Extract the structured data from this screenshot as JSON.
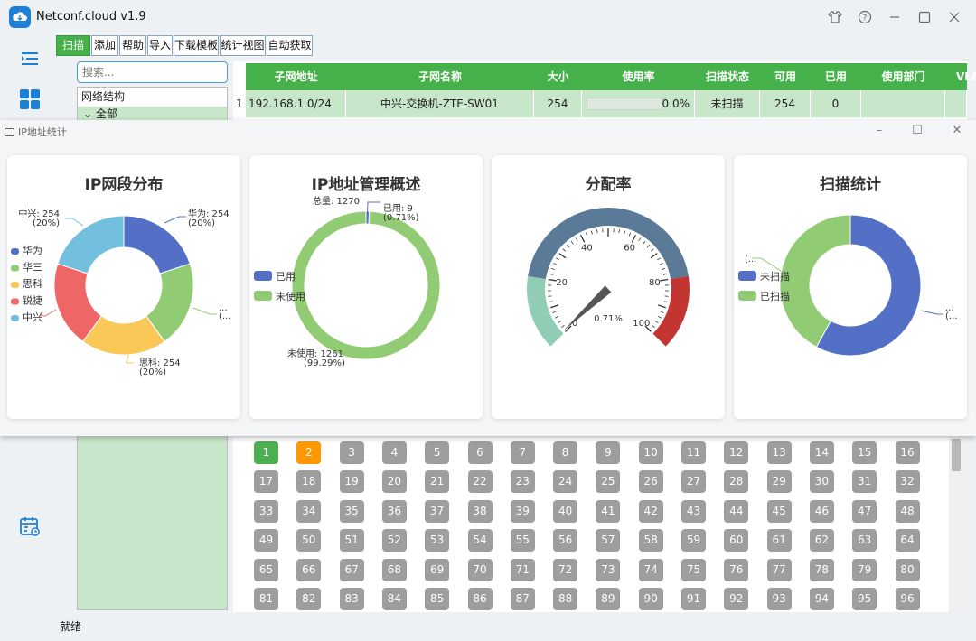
{
  "app": {
    "title": "Netconf.cloud v1.9"
  },
  "toolbar": {
    "buttons": [
      "扫描",
      "添加",
      "帮助",
      "导入",
      "下载模板",
      "统计视图",
      "自动获取"
    ]
  },
  "search": {
    "placeholder": "搜索..."
  },
  "tree": {
    "header": "网络结构",
    "root": "⌄ 全部"
  },
  "table": {
    "columns": [
      "子网地址",
      "子网名称",
      "大小",
      "使用率",
      "扫描状态",
      "可用",
      "已用",
      "使用部门",
      "VLAN"
    ],
    "rows": [
      {
        "index": "1",
        "subnet": "192.168.1.0/24",
        "name": "中兴-交换机-ZTE-SW01",
        "size": "254",
        "usage": "0.0%",
        "usage_value": 0,
        "scan_status": "未扫描",
        "available": "254",
        "used": "0",
        "dept": "",
        "vlan": ""
      }
    ]
  },
  "ip_grid": {
    "start": 1,
    "end": 96,
    "highlight": {
      "1": "#4caf50",
      "2": "#ff9800"
    },
    "default_color": "#9e9e9e"
  },
  "status_bar": {
    "text": "就绪"
  },
  "stats_window": {
    "title": "IP地址统计",
    "cards": {
      "segment": {
        "title": "IP网段分布",
        "legend": [
          "华为",
          "华三",
          "思科",
          "锐捷",
          "中兴"
        ],
        "slices": [
          {
            "name": "华为",
            "value": 254,
            "color": "#5470c6"
          },
          {
            "name": "华三",
            "value": 254,
            "color": "#91cc75"
          },
          {
            "name": "思科",
            "value": 254,
            "color": "#fac858"
          },
          {
            "name": "锐捷",
            "value": 254,
            "color": "#ee6666"
          },
          {
            "name": "中兴",
            "value": 254,
            "color": "#73c0de"
          }
        ],
        "labels": {
          "huawei": [
            "华为: 254",
            "(20%)"
          ],
          "zhongxing": [
            "中兴: 254",
            "(20%)"
          ],
          "sike": [
            "思科: 254",
            "(20%)"
          ],
          "right": [
            "...",
            "(..."
          ]
        }
      },
      "overview": {
        "title": "IP地址管理概述",
        "total": "总量: 1270",
        "legend": [
          "已用",
          "未使用"
        ],
        "slices": [
          {
            "name": "已用",
            "value": 9,
            "color": "#5470c6"
          },
          {
            "name": "未使用",
            "value": 1261,
            "color": "#91cc75"
          }
        ],
        "labels": {
          "used": [
            "已用: 9",
            "(0.71%)"
          ],
          "unused": [
            "未使用: 1261",
            "(99.29%)"
          ]
        }
      },
      "gauge": {
        "title": "分配率",
        "value": 0.71,
        "value_text": "0.71%",
        "ticks": [
          "0",
          "20",
          "40",
          "60",
          "80",
          "100"
        ],
        "colors": {
          "low": "#91ccb5",
          "mid": "#5b7a98",
          "high": "#c23531",
          "pointer": "#555555"
        }
      },
      "scan": {
        "title": "扫描统计",
        "legend": [
          "未扫描",
          "已扫描"
        ],
        "slices": [
          {
            "name": "未扫描",
            "value": 58,
            "color": "#5470c6"
          },
          {
            "name": "已扫描",
            "value": 42,
            "color": "#91cc75"
          }
        ],
        "labels": {
          "left": [
            "(..."
          ],
          "right": [
            "...",
            "(..."
          ]
        }
      }
    }
  }
}
